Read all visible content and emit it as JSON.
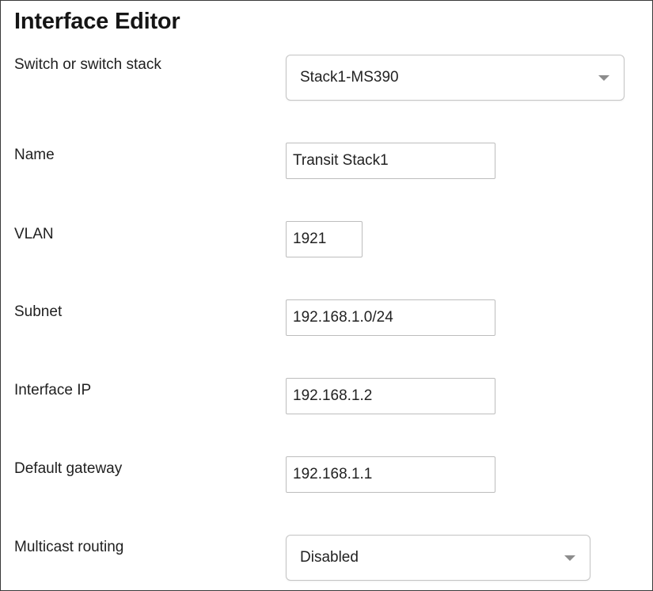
{
  "editor": {
    "title": "Interface Editor"
  },
  "fields": {
    "switch": {
      "label": "Switch or switch stack",
      "value": "Stack1-MS390"
    },
    "name": {
      "label": "Name",
      "value": "Transit Stack1"
    },
    "vlan": {
      "label": "VLAN",
      "value": "1921"
    },
    "subnet": {
      "label": "Subnet",
      "value": "192.168.1.0/24"
    },
    "interface_ip": {
      "label": "Interface IP",
      "value": "192.168.1.2"
    },
    "default_gateway": {
      "label": "Default gateway",
      "value": "192.168.1.1"
    },
    "multicast_routing": {
      "label": "Multicast routing",
      "value": "Disabled"
    }
  },
  "icons": {
    "dropdown": "chevron-down-icon"
  },
  "colors": {
    "border": "#bdbdbd",
    "caret": "#8c8c8c",
    "text": "#1f1f1f"
  }
}
